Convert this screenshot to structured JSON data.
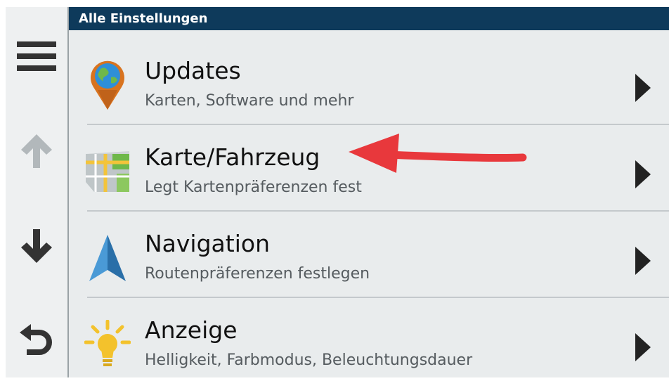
{
  "header": {
    "title": "Alle Einstellungen",
    "background": "#0e3a5b"
  },
  "rail": {
    "buttons": [
      {
        "icon": "menu-icon"
      },
      {
        "icon": "arrow-up-icon"
      },
      {
        "icon": "arrow-down-icon"
      },
      {
        "icon": "back-icon"
      }
    ]
  },
  "items": [
    {
      "title": "Updates",
      "subtitle": "Karten, Software und mehr",
      "icon": "globe-pin-icon"
    },
    {
      "title": "Karte/Fahrzeug",
      "subtitle": "Legt Kartenpräferenzen fest",
      "icon": "map-icon"
    },
    {
      "title": "Navigation",
      "subtitle": "Routenpräferenzen festlegen",
      "icon": "navigation-arrow-icon"
    },
    {
      "title": "Anzeige",
      "subtitle": "Helligkeit, Farbmodus, Beleuchtungsdauer",
      "icon": "lightbulb-icon"
    }
  ],
  "annotation": {
    "color": "#e8383c",
    "points_to": "Karte/Fahrzeug"
  }
}
